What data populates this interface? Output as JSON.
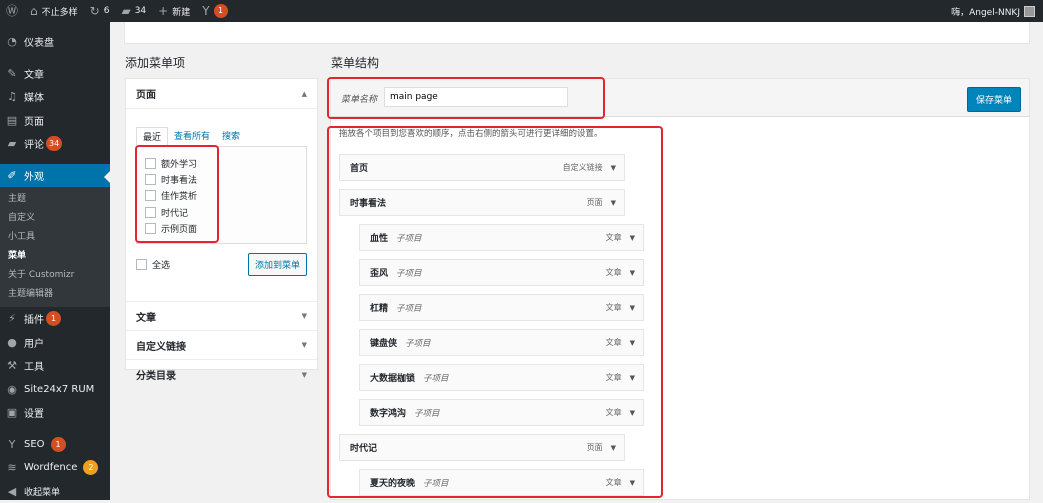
{
  "admin_bar": {
    "site_name": "不止多样",
    "updates_count": "6",
    "comments_count": "34",
    "new_label": "新建",
    "yoast_count": "1",
    "greeting": "嗨，Angel-NNKJ"
  },
  "sidebar": {
    "dashboard": "仪表盘",
    "posts": "文章",
    "media": "媒体",
    "pages": "页面",
    "comments": "评论",
    "comments_badge": "34",
    "appearance": "外观",
    "appearance_sub": [
      "主题",
      "自定义",
      "小工具",
      "菜单",
      "关于 Customizr",
      "主题编辑器"
    ],
    "plugins": "插件",
    "plugins_badge": "1",
    "users": "用户",
    "tools": "工具",
    "site24x7": "Site24x7 RUM",
    "settings": "设置",
    "seo": "SEO",
    "seo_badge": "1",
    "wordfence": "Wordfence",
    "wordfence_badge": "2",
    "collapse": "收起菜单"
  },
  "add_items": {
    "heading": "添加菜单项",
    "pages_title": "页面",
    "tabs": [
      "最近",
      "查看所有",
      "搜索"
    ],
    "pages": [
      "额外学习",
      "时事看法",
      "佳作赏析",
      "时代记",
      "示例页面"
    ],
    "select_all": "全选",
    "add_button": "添加到菜单",
    "sections": [
      "文章",
      "自定义链接",
      "分类目录"
    ]
  },
  "structure": {
    "heading": "菜单结构",
    "name_label": "菜单名称",
    "name_value": "main page",
    "save_button": "保存菜单",
    "instructions": "拖放各个项目到您喜欢的顺序，点击右侧的箭头可进行更详细的设置。",
    "sub_item_label": "子项目",
    "items": [
      {
        "title": "首页",
        "type": "自定义链接",
        "depth": 0
      },
      {
        "title": "时事看法",
        "type": "页面",
        "depth": 0
      },
      {
        "title": "血性",
        "type": "文章",
        "depth": 1
      },
      {
        "title": "歪风",
        "type": "文章",
        "depth": 1
      },
      {
        "title": "杠精",
        "type": "文章",
        "depth": 1
      },
      {
        "title": "键盘侠",
        "type": "文章",
        "depth": 1
      },
      {
        "title": "大数据枷锁",
        "type": "文章",
        "depth": 1
      },
      {
        "title": "数字鸿沟",
        "type": "文章",
        "depth": 1
      },
      {
        "title": "时代记",
        "type": "页面",
        "depth": 0
      },
      {
        "title": "夏天的夜晚",
        "type": "文章",
        "depth": 1
      }
    ]
  },
  "colors": {
    "accent": "#0073aa",
    "highlight_box": "#e3262e",
    "admin_bg": "#23282d"
  }
}
